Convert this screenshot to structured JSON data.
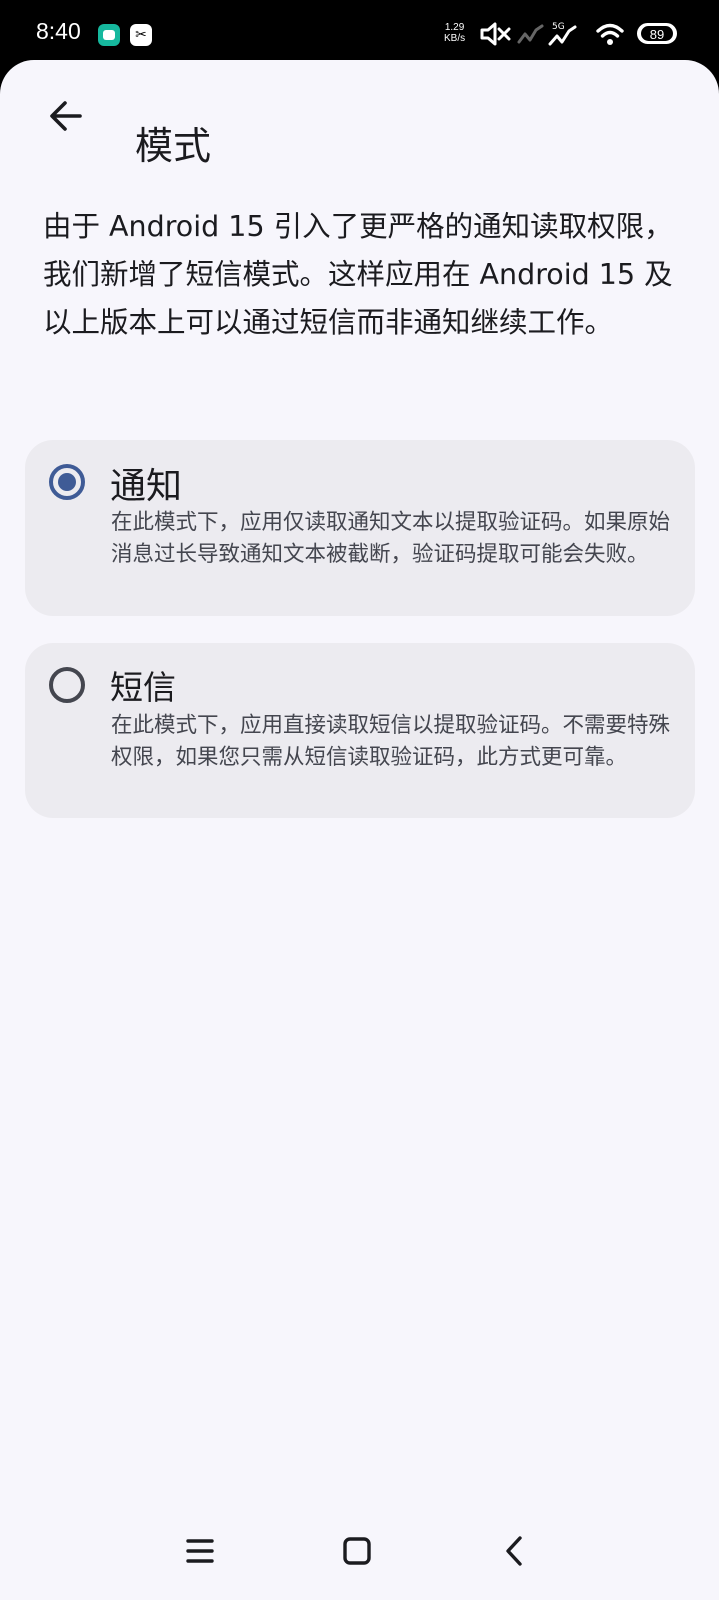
{
  "status_bar": {
    "time": "8:40",
    "net_speed_value": "1.29",
    "net_speed_unit": "KB/s",
    "network": "5G",
    "battery": "89",
    "icons": [
      "chat-app-icon",
      "capcut-icon",
      "mute-icon",
      "signal-icon",
      "signal-5g-icon",
      "wifi-icon",
      "battery-icon"
    ]
  },
  "toolbar": {
    "back_icon": "arrow-back-icon",
    "title": "模式"
  },
  "intro_text": "由于 Android 15 引入了更严格的通知读取权限，我们新增了短信模式。这样应用在 Android 15 及以上版本上可以通过短信而非通知继续工作。",
  "options": [
    {
      "title": "通知",
      "description": "在此模式下，应用仅读取通知文本以提取验证码。如果原始消息过长导致通知文本被截断，验证码提取可能会失败。",
      "selected": true
    },
    {
      "title": "短信",
      "description": "在此模式下，应用直接读取短信以提取验证码。不需要特殊权限，如果您只需从短信读取验证码，此方式更可靠。",
      "selected": false
    }
  ],
  "colors": {
    "background": "#f7f6fc",
    "card": "#ecebf0",
    "accent": "#3f5b96",
    "text": "#1b1b1f",
    "secondary_text": "#44464f"
  },
  "nav_bar": {
    "icons": [
      "menu-icon",
      "home-icon",
      "back-icon"
    ]
  }
}
